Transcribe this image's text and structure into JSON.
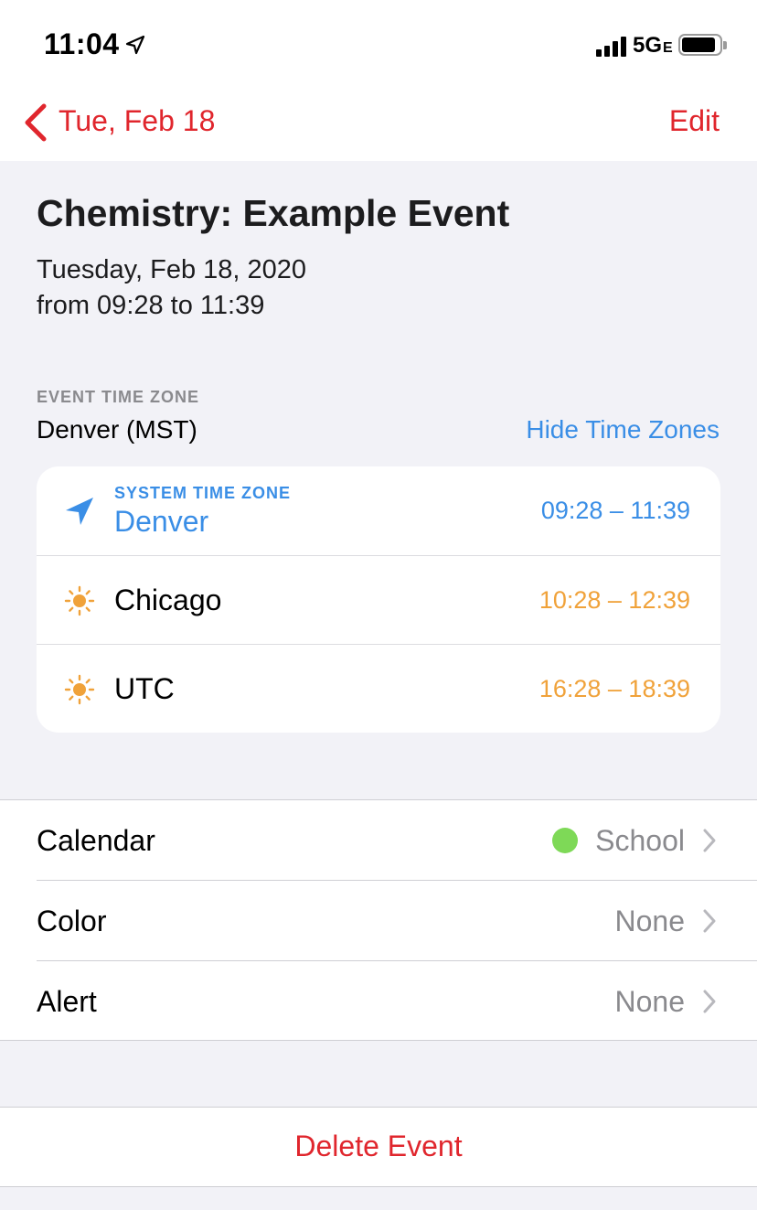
{
  "status_bar": {
    "time": "11:04",
    "network": "5G",
    "network_sub": "E",
    "icons": [
      "location-arrow-icon",
      "signal-bars-icon",
      "battery-icon"
    ]
  },
  "nav": {
    "back_label": "Tue, Feb 18",
    "edit_label": "Edit",
    "accent_color": "#e0262d"
  },
  "event": {
    "title": "Chemistry: Example Event",
    "date_line": "Tuesday, Feb 18, 2020",
    "time_line": "from 09:28 to 11:39"
  },
  "time_zone": {
    "header": "EVENT TIME ZONE",
    "value": "Denver (MST)",
    "hide_label": "Hide Time Zones",
    "rows": [
      {
        "label": "SYSTEM TIME ZONE",
        "city": "Denver",
        "time": "09:28 – 11:39",
        "icon": "location-arrow-icon",
        "color": "#3a8ee6"
      },
      {
        "city": "Chicago",
        "time": "10:28 – 12:39",
        "icon": "sun-icon",
        "color": "#f0a23a"
      },
      {
        "city": "UTC",
        "time": "16:28 – 18:39",
        "icon": "sun-icon",
        "color": "#f0a23a"
      }
    ]
  },
  "settings": {
    "calendar": {
      "label": "Calendar",
      "value": "School",
      "dot_color": "#7ed957"
    },
    "color": {
      "label": "Color",
      "value": "None"
    },
    "alert": {
      "label": "Alert",
      "value": "None"
    }
  },
  "delete_label": "Delete Event"
}
